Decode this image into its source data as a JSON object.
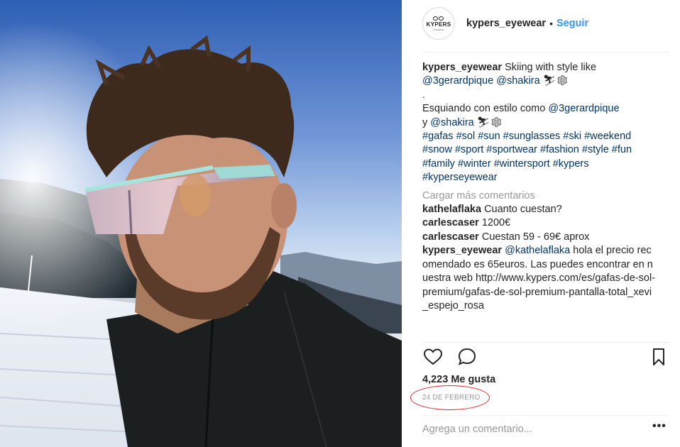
{
  "post": {
    "username": "kypers_eyewear",
    "follow_label": "Seguir",
    "separator": "•",
    "logo": {
      "text": "KYPERS",
      "subtext": "EYEWEAR"
    },
    "caption": {
      "username": "kypers_eyewear",
      "line1": "Skiing with style like",
      "mention1": "@3gerardpique",
      "mention2": "@shakira",
      "emoji1": "⛷❄",
      "dot": ".",
      "line2": "Esquiando con estilo como",
      "mention3": "@3gerardpique",
      "y": "y",
      "mention4": "@shakira",
      "emoji2": "⛷❄",
      "hashtags": "#gafas #sol #sun #sunglasses #ski #weekend #snow #sport #sportwear #fashion #style #fun #family #winter #wintersport #kypers #kyperseyewear"
    },
    "load_more": "Cargar más comentarios",
    "comments": [
      {
        "user": "kathelaflaka",
        "text": "Cuanto cuestan?"
      },
      {
        "user": "carlescaser",
        "text": "1200€"
      },
      {
        "user": "carlescaser",
        "text": "Cuestan 59 - 69€ aprox"
      }
    ],
    "reply": {
      "user": "kypers_eyewear",
      "mention": "@kathelaflaka",
      "text": "hola el precio recomendado es 65euros. Las puedes encontrar en nuestra web http://www.kypers.com/es/gafas-de-sol-premium/gafas-de-sol-premium-pantalla-total_xevi_espejo_rosa"
    },
    "likes": "4,223 Me gusta",
    "date": "24 DE FEBRERO",
    "add_comment_placeholder": "Agrega un comentario...",
    "more_label": "•••"
  },
  "icons": {
    "like": "heart-icon",
    "comment": "speech-bubble-icon",
    "save": "bookmark-icon"
  },
  "colors": {
    "link": "#003569",
    "follow": "#3897f0",
    "date_highlight": "#d42a2a"
  }
}
